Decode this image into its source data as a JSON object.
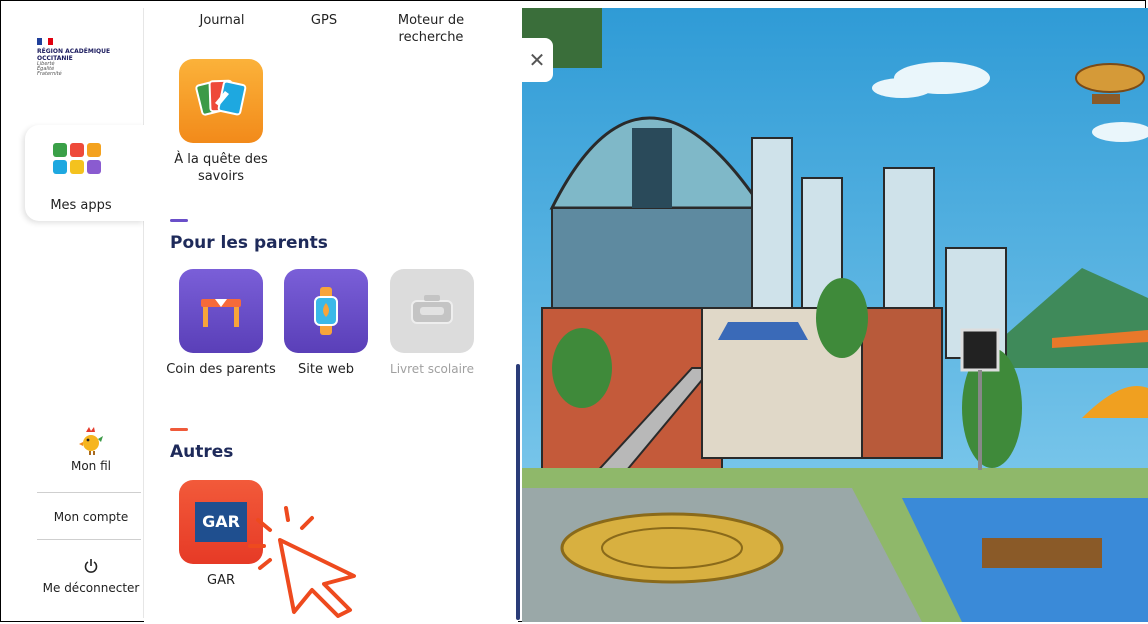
{
  "top_links": [
    "Journal",
    "GPS",
    "Moteur de recherche"
  ],
  "logo": {
    "line1": "RÉGION ACADÉMIQUE",
    "line2": "OCCITANIE",
    "motto1": "Liberté",
    "motto2": "Égalité",
    "motto3": "Fraternité"
  },
  "rail": {
    "apps_label": "Mes apps",
    "mon_fil": "Mon fil",
    "mon_compte": "Mon compte",
    "logout": "Me déconnecter"
  },
  "panel": {
    "quest_app": "À la quête des savoirs",
    "parents_title": "Pour les parents",
    "parents_apps": [
      "Coin des parents",
      "Site web",
      "Livret scolaire"
    ],
    "others_title": "Autres",
    "gar_tile": "GAR",
    "gar_label": "GAR"
  },
  "close_icon": "✕",
  "colors": {
    "orange": "#f79a1e",
    "purple": "#6a4fc9",
    "grey": "#d6d6d6",
    "red": "#ef4a32",
    "gar_blue": "#1f4f8f"
  }
}
